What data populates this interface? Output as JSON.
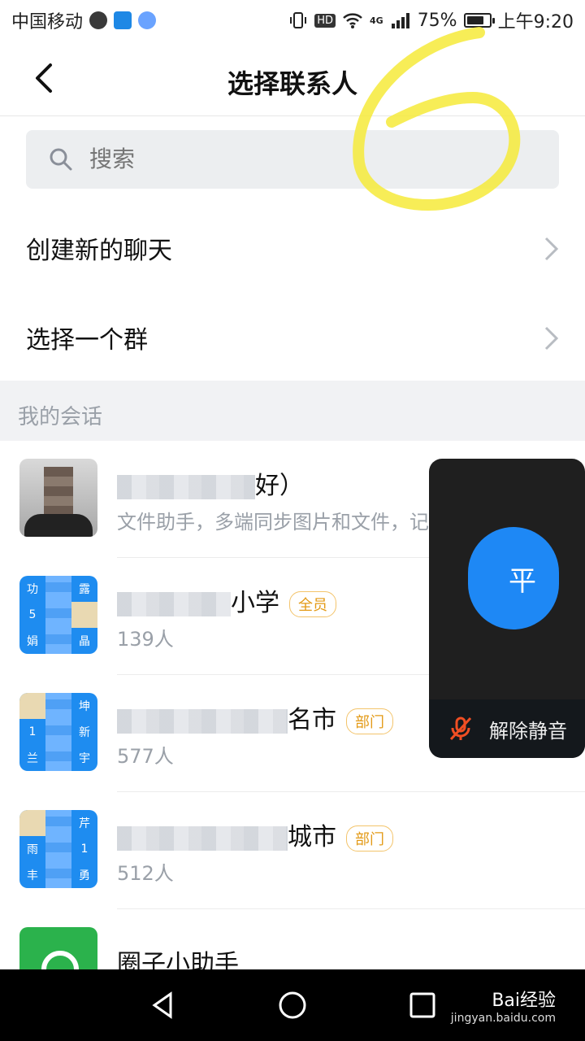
{
  "status_bar": {
    "carrier": "中国移动",
    "battery_percent": "75%",
    "time": "上午9:20",
    "hd_badge": "HD",
    "signal_label": "4G",
    "battery_level": 0.75,
    "icons": [
      "notification-icon",
      "alipay-icon",
      "browser-icon",
      "vibrate-icon",
      "wifi-icon",
      "signal-icon",
      "battery-icon"
    ]
  },
  "header": {
    "title": "选择联系人"
  },
  "search": {
    "placeholder": "搜索"
  },
  "options": [
    {
      "label": "创建新的聊天"
    },
    {
      "label": "选择一个群"
    }
  ],
  "section": {
    "label": "我的会话"
  },
  "conversations": [
    {
      "title_visible": "好）",
      "subtitle": "文件助手，多端同步图片和文件，记"
    },
    {
      "title_visible": "小学",
      "badge": "全员",
      "count": "139人"
    },
    {
      "title_visible": "名市",
      "badge": "部门",
      "count": "577人"
    },
    {
      "title_visible": "城市",
      "badge": "部门",
      "count": "512人"
    },
    {
      "title_visible": "圈子小助手"
    }
  ],
  "avatar_grids": [
    [
      "功",
      "",
      "露",
      "5",
      "",
      "",
      "娟",
      "",
      "晶"
    ],
    [
      "",
      "",
      "坤",
      "1",
      "",
      "新",
      "兰",
      "",
      "宇"
    ],
    [
      "",
      "",
      "芹",
      "雨",
      "",
      "1",
      "丰",
      "",
      "勇"
    ]
  ],
  "floating_call": {
    "avatar_char": "平",
    "unmute_label": "解除静音"
  },
  "watermark": {
    "brand": "Bai经验",
    "url": "jingyan.baidu.com"
  },
  "colors": {
    "accent_blue": "#1e88f5",
    "badge_orange": "#e39a16",
    "annotation_yellow": "#f6ea3a"
  }
}
